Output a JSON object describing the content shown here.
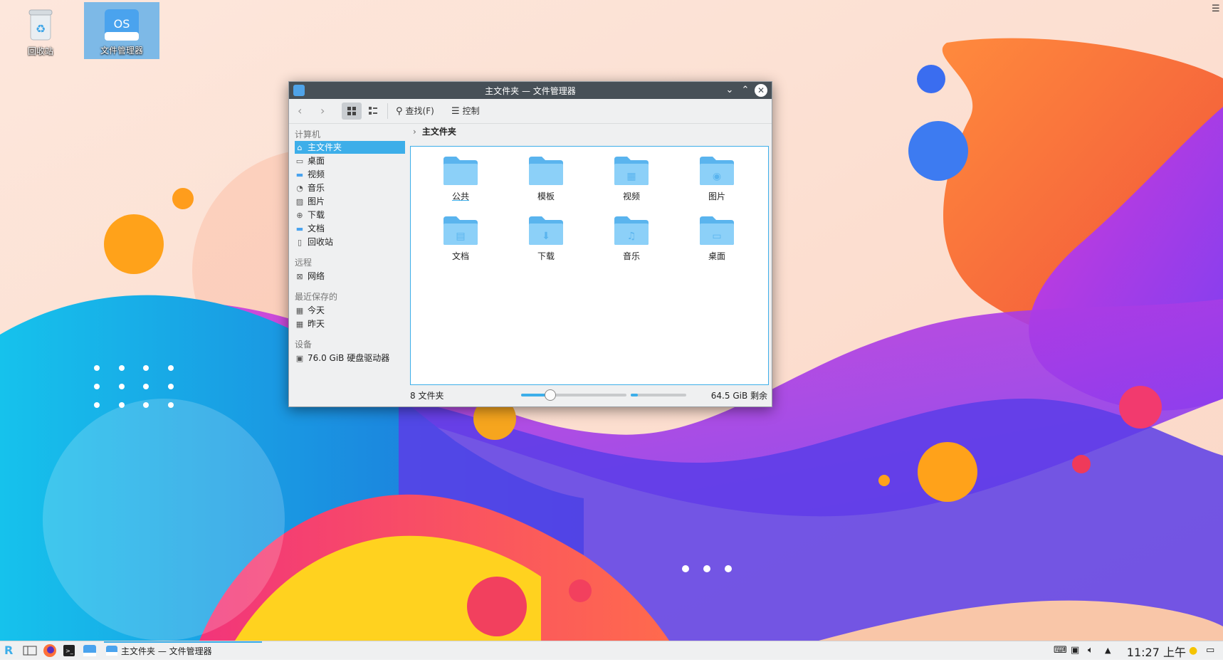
{
  "desktop": {
    "icons": [
      {
        "label": "回收站",
        "icon": "trash-icon"
      },
      {
        "label": "文件管理器",
        "icon": "file-manager-icon",
        "badge": "OS"
      }
    ]
  },
  "window": {
    "title": "主文件夹 — 文件管理器",
    "toolbar": {
      "back_icon": "chevron-left-icon",
      "forward_icon": "chevron-right-icon",
      "find_label": "查找(F)",
      "control_label": "控制"
    },
    "sidebar": {
      "computer_heading": "计算机",
      "computer_items": [
        {
          "label": "主文件夹",
          "icon": "home-icon",
          "active": true
        },
        {
          "label": "桌面",
          "icon": "desktop-icon"
        },
        {
          "label": "视频",
          "icon": "folder-icon"
        },
        {
          "label": "音乐",
          "icon": "music-icon"
        },
        {
          "label": "图片",
          "icon": "image-icon"
        },
        {
          "label": "下载",
          "icon": "download-icon"
        },
        {
          "label": "文档",
          "icon": "folder-icon"
        },
        {
          "label": "回收站",
          "icon": "trash-icon"
        }
      ],
      "remote_heading": "远程",
      "remote_items": [
        {
          "label": "网络",
          "icon": "network-icon"
        }
      ],
      "recent_heading": "最近保存的",
      "recent_items": [
        {
          "label": "今天",
          "icon": "calendar-icon"
        },
        {
          "label": "昨天",
          "icon": "calendar-icon"
        }
      ],
      "devices_heading": "设备",
      "device_items": [
        {
          "label": "76.0 GiB 硬盘驱动器",
          "icon": "drive-icon"
        }
      ]
    },
    "breadcrumb": "主文件夹",
    "folders": [
      "公共",
      "模板",
      "视频",
      "图片",
      "文档",
      "下载",
      "音乐",
      "桌面"
    ],
    "status": {
      "count_text": "8 文件夹",
      "zoom_level": 0.27,
      "space_used_fraction": 0.13,
      "free_text": "64.5 GiB 剩余"
    }
  },
  "taskbar": {
    "active_task": "主文件夹 — 文件管理器",
    "clock": "11:27 上午"
  },
  "colors": {
    "accent": "#3daee9",
    "titlebar": "#475057",
    "folder": "#5ab4ee"
  }
}
